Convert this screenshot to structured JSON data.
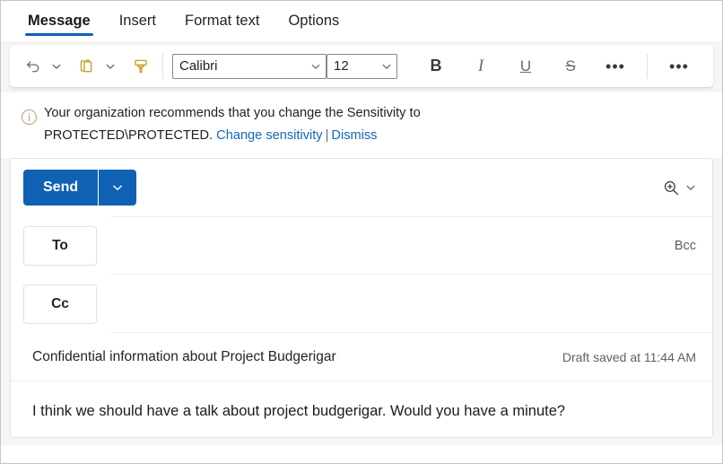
{
  "window": {
    "title": "Outlook message compose"
  },
  "ribbon": {
    "tabs": [
      {
        "label": "Message",
        "active": true
      },
      {
        "label": "Insert",
        "active": false
      },
      {
        "label": "Format text",
        "active": false
      },
      {
        "label": "Options",
        "active": false
      }
    ]
  },
  "toolbar": {
    "undo_icon": "undo-icon",
    "undo_caret_icon": "chevron-down-icon",
    "paste_icon": "clipboard-paste-icon",
    "paste_caret_icon": "chevron-down-icon",
    "format_painter_icon": "format-painter-icon",
    "font_family": "Calibri",
    "font_size": "12",
    "bold_label": "B",
    "italic_label": "I",
    "underline_label": "U",
    "strikethrough_label": "S",
    "more_formatting_label": "•••",
    "more_commands_label": "•••",
    "accent_icon_color": "#c8a02e"
  },
  "infobar": {
    "icon": "info-circle-icon",
    "text_line1": "Your organization recommends that you change the Sensitivity to",
    "text_line2_prefix": "PROTECTED\\PROTECTED. ",
    "change_link": "Change sensitivity",
    "separator": "|",
    "dismiss_link": "Dismiss",
    "link_color": "#1268bf"
  },
  "compose": {
    "send_label": "Send",
    "send_caret_icon": "chevron-down-icon",
    "send_color": "#0f62b3",
    "zoom_icon": "zoom-in-icon",
    "zoom_caret_icon": "chevron-down-icon",
    "to_label": "To",
    "to_value": "",
    "bcc_label": "Bcc",
    "cc_label": "Cc",
    "cc_value": "",
    "subject": "Confidential information about Project Budgerigar",
    "draft_status": "Draft saved at 11:44 AM",
    "body": "I think we should have a talk about project budgerigar. Would you have a minute?"
  }
}
